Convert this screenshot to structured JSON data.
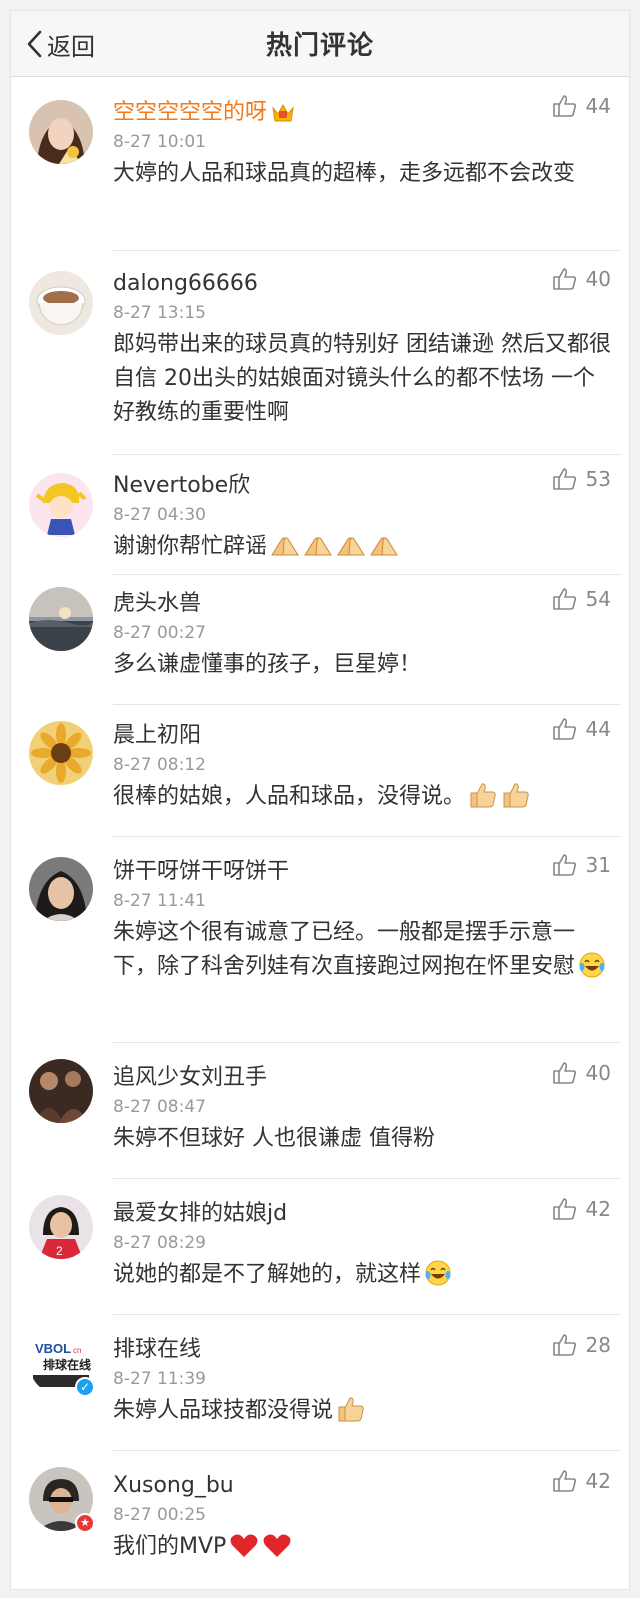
{
  "header": {
    "back_label": "返回",
    "title": "热门评论"
  },
  "comments": [
    {
      "user": "空空空空空的呀",
      "time": "8-27 10:01",
      "text": "大婷的人品和球品真的超棒，走多远都不会改变",
      "likes": "44"
    },
    {
      "user": "dalong66666",
      "time": "8-27 13:15",
      "text": "郎妈带出来的球员真的特别好 团结谦逊 然后又都很自信 20出头的姑娘面对镜头什么的都不怯场 一个好教练的重要性啊",
      "likes": "40"
    },
    {
      "user": "Nevertobe欣",
      "time": "8-27 04:30",
      "text": "谢谢你帮忙辟谣",
      "likes": "53"
    },
    {
      "user": "虎头水兽",
      "time": "8-27 00:27",
      "text": "多么谦虚懂事的孩子，巨星婷！",
      "likes": "54"
    },
    {
      "user": "晨上初阳",
      "time": "8-27 08:12",
      "text": "很棒的姑娘，人品和球品，没得说。",
      "likes": "44"
    },
    {
      "user": "饼干呀饼干呀饼干",
      "time": "8-27 11:41",
      "text": "朱婷这个很有诚意了已经。一般都是摆手示意一下，除了科舍列娃有次直接跑过网抱在怀里安慰",
      "likes": "31"
    },
    {
      "user": "追风少女刘丑手",
      "time": "8-27 08:47",
      "text": "朱婷不但球好 人也很谦虚 值得粉",
      "likes": "40"
    },
    {
      "user": "最爱女排的姑娘jd",
      "time": "8-27 08:29",
      "text": "说她的都是不了解她的，就这样",
      "likes": "42"
    },
    {
      "user": "排球在线",
      "time": "8-27 11:39",
      "text": "朱婷人品球技都没得说",
      "likes": "28"
    },
    {
      "user": "Xusong_bu",
      "time": "8-27 00:25",
      "text": "我们的MVP",
      "likes": "42"
    }
  ],
  "avatar_logo_text": "排球在线"
}
